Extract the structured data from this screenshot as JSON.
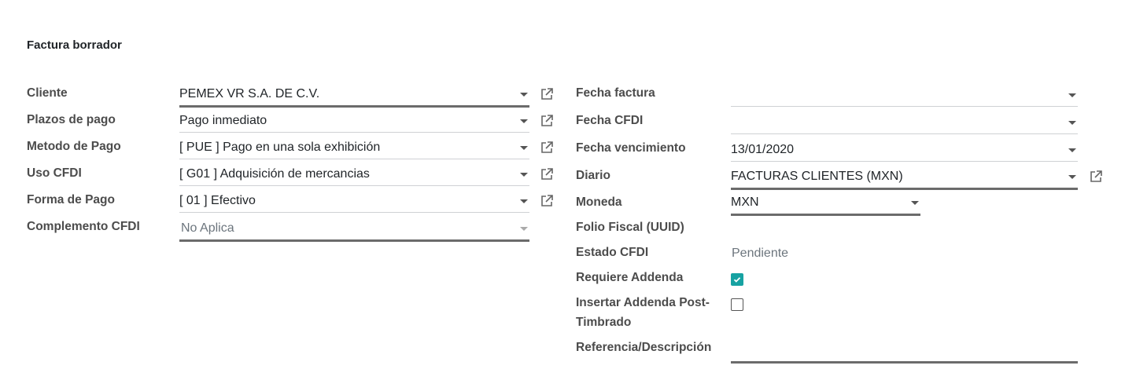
{
  "form": {
    "title": "Factura borrador"
  },
  "left": {
    "cliente": {
      "label": "Cliente",
      "value": "PEMEX VR S.A. DE C.V."
    },
    "plazos": {
      "label": "Plazos de pago",
      "value": "Pago inmediato"
    },
    "metodo": {
      "label": "Metodo de Pago",
      "value": "[ PUE ] Pago en una sola exhibición"
    },
    "uso": {
      "label": "Uso CFDI",
      "value": "[ G01 ] Adquisición de mercancias"
    },
    "forma": {
      "label": "Forma de Pago",
      "value": "[ 01 ] Efectivo"
    },
    "complemento": {
      "label": "Complemento CFDI",
      "value": "No Aplica"
    }
  },
  "right": {
    "fecha_factura": {
      "label": "Fecha factura",
      "value": ""
    },
    "fecha_cfdi": {
      "label": "Fecha CFDI",
      "value": ""
    },
    "fecha_venc": {
      "label": "Fecha vencimiento",
      "value": "13/01/2020"
    },
    "diario": {
      "label": "Diario",
      "value": "FACTURAS CLIENTES (MXN)"
    },
    "moneda": {
      "label": "Moneda",
      "value": "MXN"
    },
    "folio": {
      "label": "Folio Fiscal (UUID)",
      "value": ""
    },
    "estado": {
      "label": "Estado CFDI",
      "value": "Pendiente"
    },
    "requiere_addenda": {
      "label": "Requiere Addenda",
      "checked": true
    },
    "insertar_addenda": {
      "label_line1": "Insertar Addenda Post-",
      "label_line2": "Timbrado",
      "checked": false
    },
    "referencia": {
      "label": "Referencia/Descripción",
      "value": ""
    }
  },
  "colors": {
    "accent": "#17a2a2",
    "label": "#4c4c4c",
    "required_border": "#6b6b6b"
  },
  "icons": {
    "external_link": "external-link-icon",
    "dropdown": "caret-down-icon",
    "checkmark": "check-icon"
  }
}
